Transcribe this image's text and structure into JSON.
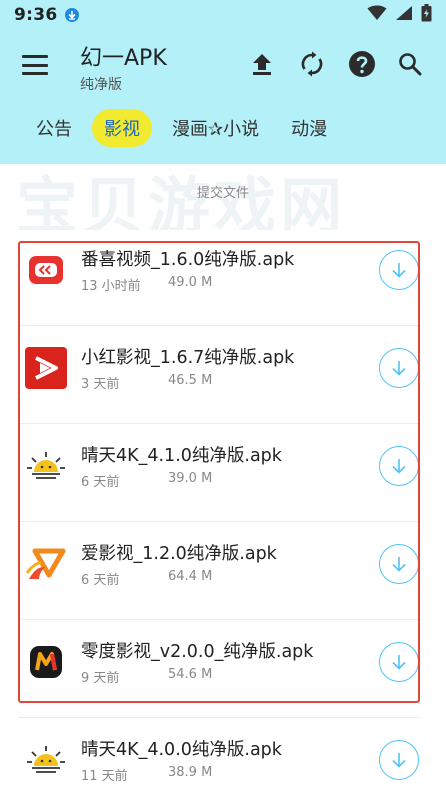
{
  "status_bar": {
    "time": "9:36"
  },
  "app_bar": {
    "title": "幻一APK",
    "subtitle": "纯净版",
    "actions": [
      "upload-icon",
      "refresh-icon",
      "help-icon",
      "search-icon"
    ]
  },
  "tabs": [
    {
      "label": "公告",
      "active": false
    },
    {
      "label": "影视",
      "active": true
    },
    {
      "label": "漫画✰小说",
      "active": false
    },
    {
      "label": "动漫",
      "active": false
    }
  ],
  "banner": {
    "watermark": "宝贝游戏网",
    "submit_text": "提交文件"
  },
  "files": [
    {
      "name": "番喜视频_1.6.0纯净版.apk",
      "time": "13 小时前",
      "size": "49.0 M",
      "icon": "fanxi-app-icon"
    },
    {
      "name": "小红影视_1.6.7纯净版.apk",
      "time": "3 天前",
      "size": "46.5 M",
      "icon": "xiaohong-app-icon"
    },
    {
      "name": "晴天4K_4.1.0纯净版.apk",
      "time": "6 天前",
      "size": "39.0 M",
      "icon": "qingtian-app-icon"
    },
    {
      "name": "爱影视_1.2.0纯净版.apk",
      "time": "6 天前",
      "size": "64.4 M",
      "icon": "aiyingshi-app-icon"
    },
    {
      "name": "零度影视_v2.0.0_纯净版.apk",
      "time": "9 天前",
      "size": "54.6 M",
      "icon": "lingdu-app-icon"
    },
    {
      "name": "晴天4K_4.0.0纯净版.apk",
      "time": "11 天前",
      "size": "38.9 M",
      "icon": "qingtian-app-icon"
    }
  ],
  "colors": {
    "header_bg": "#b3f0f8",
    "active_tab_bg": "#f2ea2e",
    "active_tab_text": "#1a66c8",
    "download_ring": "#4fc3f7",
    "highlight_border": "#e0463a"
  }
}
